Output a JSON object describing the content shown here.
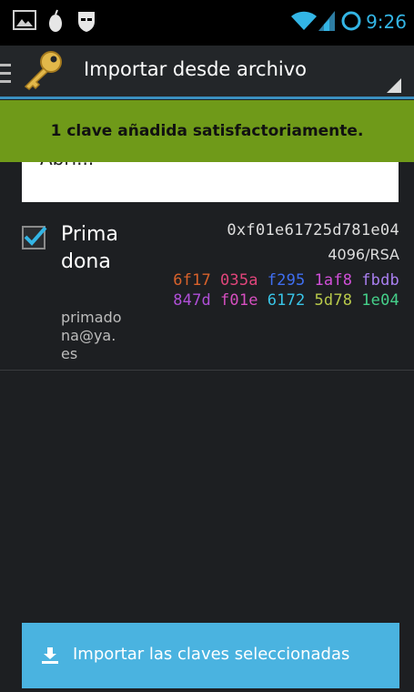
{
  "status_bar": {
    "time": "9:26"
  },
  "action_bar": {
    "title": "Importar desde archivo"
  },
  "file_card": {
    "partial_label": "Abri..."
  },
  "toast": {
    "message": "1 clave añadida satisfactoriamente."
  },
  "key_item": {
    "checked": true,
    "name": "Primadona",
    "email": "primadona@ya.es",
    "key_id": "0xf01e61725d781e04",
    "algorithm": "4096/RSA",
    "fingerprint_row1": [
      "6f17",
      "035a",
      "f295",
      "1af8",
      "fbdb"
    ],
    "fingerprint_row2": [
      "847d",
      "f01e",
      "6172",
      "5d78",
      "1e04"
    ],
    "fingerprint_colors_row1": [
      "#d9622b",
      "#e0457b",
      "#3f6ef0",
      "#d04fd8",
      "#a97ff0"
    ],
    "fingerprint_colors_row2": [
      "#b04fd8",
      "#d64fc0",
      "#39c5e8",
      "#b8c94a",
      "#45d08a"
    ]
  },
  "import_button": {
    "label": "Importar las claves seleccionadas"
  },
  "colors": {
    "accent_blue": "#33b5e5",
    "toast_green": "#6f9a19",
    "button_blue": "#4ab3e0",
    "background": "#1d1f22"
  }
}
